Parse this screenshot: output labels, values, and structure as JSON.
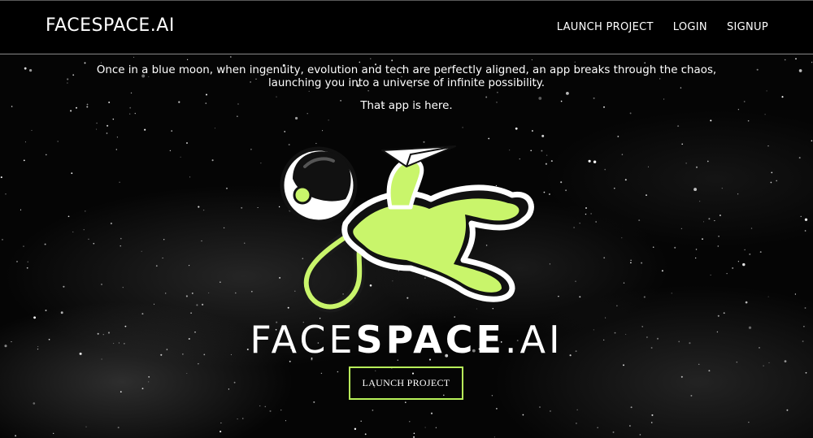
{
  "nav": {
    "brand": "FACESPACE.AI",
    "links": [
      "LAUNCH PROJECT",
      "LOGIN",
      "SIGNUP"
    ]
  },
  "hero": {
    "intro_line1": "Once in a blue moon, when ingenuity, evolution and tech are perfectly aligned, an app breaks through the chaos,",
    "intro_line2": "launching you into a universe of infinite possibility.",
    "subline": "That app is here.",
    "logo_face": "FACE",
    "logo_space": "SPACE",
    "logo_dot_ai": ".AI",
    "cta_label": "LAUNCH PROJECT"
  },
  "colors": {
    "accent": "#c9f56b",
    "button_border": "#b8f25a",
    "background": "#000000",
    "text": "#ffffff"
  },
  "icons": {
    "mascot": "astronaut-icon",
    "paper_plane": "paper-plane-icon"
  }
}
